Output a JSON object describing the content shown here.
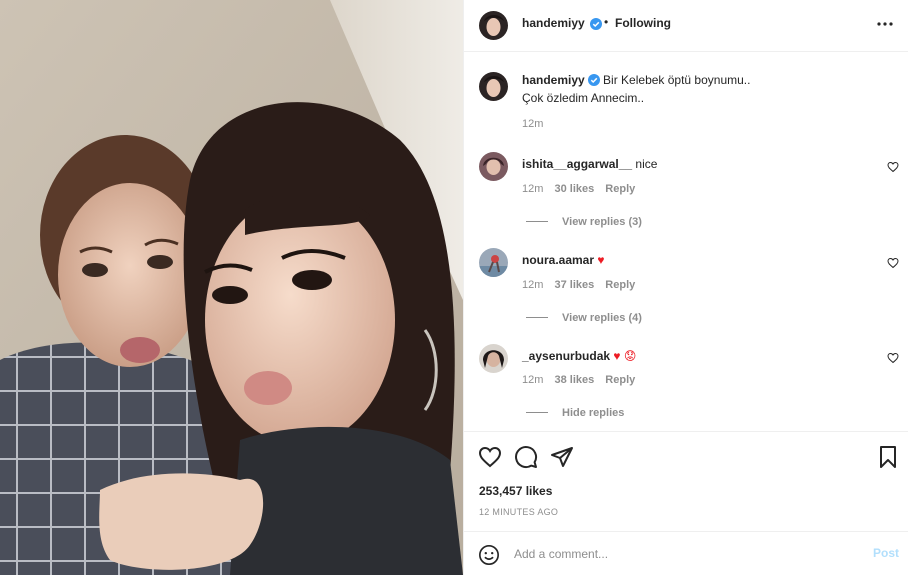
{
  "post": {
    "author": "handemiyy",
    "follow_dot": "•",
    "follow_status": "Following",
    "caption_line1": "Bir Kelebek öptü boynumu..",
    "caption_line2": "Çok özledim Annecim..",
    "caption_time": "12m",
    "likes": "253,457 likes",
    "posted_ago": "12 MINUTES AGO"
  },
  "comments": [
    {
      "user": "ishita__aggarwal__",
      "text": "nice",
      "time": "12m",
      "likes": "30 likes",
      "reply": "Reply",
      "replies": "View replies (3)"
    },
    {
      "user": "noura.aamar",
      "text": "♥",
      "time": "12m",
      "likes": "37 likes",
      "reply": "Reply",
      "replies": "View replies (4)"
    },
    {
      "user": "_aysenurbudak",
      "text": "♥ 😟",
      "time": "12m",
      "likes": "38 likes",
      "reply": "Reply",
      "replies": "Hide replies"
    }
  ],
  "composer": {
    "placeholder": "Add a comment...",
    "post_label": "Post"
  },
  "colors": {
    "verified": "#3897f0",
    "heart": "#ed1c24",
    "post_disabled": "#b2dffc",
    "muted": "#8e8e8e"
  },
  "icons": [
    "verified-icon",
    "more-options-icon",
    "heart-icon",
    "comment-icon",
    "share-icon",
    "bookmark-icon",
    "emoji-icon"
  ]
}
